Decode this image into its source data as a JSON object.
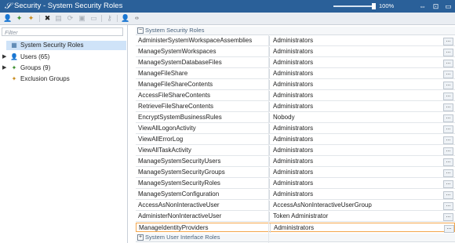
{
  "window": {
    "title": "Security - System Security Roles",
    "zoom": "100%"
  },
  "title_icons": [
    "restore-icon",
    "maximize-icon"
  ],
  "toolbar": {
    "icons": [
      "user-icon",
      "group-icon",
      "group-add-icon",
      "delete-icon",
      "document-icon",
      "refresh-icon",
      "save-icon",
      "print-icon",
      "key-icon",
      "user-edit-icon",
      "code-icon"
    ]
  },
  "filter": {
    "placeholder": "Filter"
  },
  "tree": [
    {
      "label": "System Security Roles",
      "icon": "table-icon",
      "expander": "",
      "selected": true
    },
    {
      "label": "Users (65)",
      "icon": "user-icon",
      "expander": "▶",
      "selected": false
    },
    {
      "label": "Groups (9)",
      "icon": "group-icon",
      "expander": "▶",
      "selected": false
    },
    {
      "label": "Exclusion Groups",
      "icon": "group-icon",
      "expander": "",
      "selected": false
    }
  ],
  "groups": [
    {
      "sign": "−",
      "title": "System Security Roles"
    },
    {
      "sign": "+",
      "title": "System User Interface Roles"
    }
  ],
  "properties": [
    {
      "name": "AdministerSystemWorkspaceAssemblies",
      "value": "Administrators"
    },
    {
      "name": "ManageSystemWorkspaces",
      "value": "Administrators"
    },
    {
      "name": "ManageSystemDatabaseFiles",
      "value": "Administrators"
    },
    {
      "name": "ManageFileShare",
      "value": "Administrators"
    },
    {
      "name": "ManageFileShareContents",
      "value": "Administrators"
    },
    {
      "name": "AccessFileShareContents",
      "value": "Administrators"
    },
    {
      "name": "RetrieveFileShareContents",
      "value": "Administrators"
    },
    {
      "name": "EncryptSystemBusinessRules",
      "value": "Nobody"
    },
    {
      "name": "ViewAllLogonActivity",
      "value": "Administrators"
    },
    {
      "name": "ViewAllErrorLog",
      "value": "Administrators"
    },
    {
      "name": "ViewAllTaskActivity",
      "value": "Administrators"
    },
    {
      "name": "ManageSystemSecurityUsers",
      "value": "Administrators"
    },
    {
      "name": "ManageSystemSecurityGroups",
      "value": "Administrators"
    },
    {
      "name": "ManageSystemSecurityRoles",
      "value": "Administrators"
    },
    {
      "name": "ManageSystemConfiguration",
      "value": "Administrators"
    },
    {
      "name": "AccessAsNonInteractiveUser",
      "value": "AccessAsNonInteractiveUserGroup"
    },
    {
      "name": "AdministerNonInteractiveUser",
      "value": "Token Administrator"
    },
    {
      "name": "ManageIdentityProviders",
      "value": "Administrators"
    }
  ],
  "ellipsis_label": "...",
  "colors": {
    "titlebar": "#2a6099",
    "selection": "#cfe3f8",
    "active_border": "#f3a64d"
  }
}
